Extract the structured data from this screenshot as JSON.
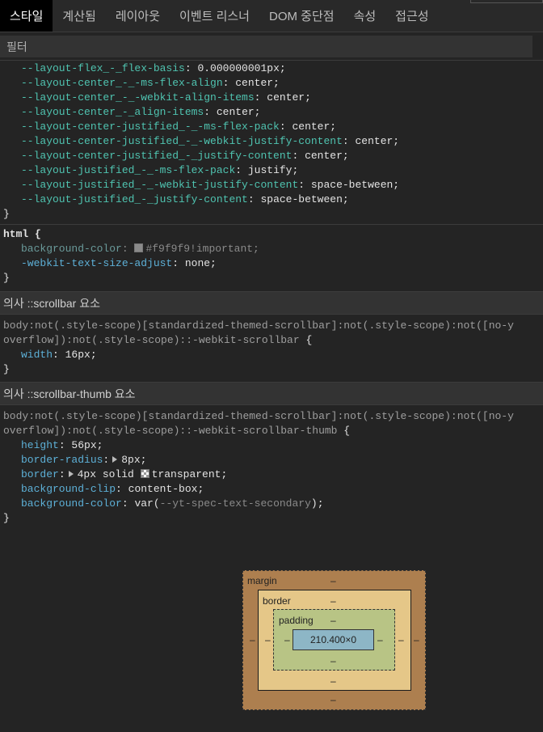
{
  "tabs": [
    "스타일",
    "계산됨",
    "레이아웃",
    "이벤트 리스너",
    "DOM 중단점",
    "속성",
    "접근성"
  ],
  "filter_placeholder": "필터",
  "rule1": {
    "decls": [
      {
        "prop": "--layout-flex_-_flex-basis",
        "value": "0.000000001px;"
      },
      {
        "prop": "--layout-center_-_-ms-flex-align",
        "value": "center;"
      },
      {
        "prop": "--layout-center_-_-webkit-align-items",
        "value": "center;"
      },
      {
        "prop": "--layout-center_-_align-items",
        "value": "center;"
      },
      {
        "prop": "--layout-center-justified_-_-ms-flex-pack",
        "value": "center;"
      },
      {
        "prop": "--layout-center-justified_-_-webkit-justify-content",
        "value": "center;"
      },
      {
        "prop": "--layout-center-justified_-_justify-content",
        "value": "center;"
      },
      {
        "prop": "--layout-justified_-_-ms-flex-pack",
        "value": "justify;"
      },
      {
        "prop": "--layout-justified_-_-webkit-justify-content",
        "value": "space-between;"
      },
      {
        "prop": "--layout-justified_-_justify-content",
        "value": "space-between;"
      }
    ],
    "close": "}"
  },
  "rule2": {
    "selector": "html {",
    "decl1_prop": "background-color",
    "decl1_value": "#f9f9f9!important;",
    "decl1_color": "#f9f9f9",
    "decl2_prop": "-webkit-text-size-adjust",
    "decl2_value": "none;",
    "close": "}"
  },
  "section1": "의사 ::scrollbar 요소",
  "rule3": {
    "selector_line1": "body:not(.style-scope)[standardized-themed-scrollbar]:not(.style-scope):not([no-y",
    "selector_line2": "overflow]):not(.style-scope)::-webkit-scrollbar",
    "brace": " {",
    "decl_prop": "width",
    "decl_value": "16px;",
    "close": "}"
  },
  "section2": "의사 ::scrollbar-thumb 요소",
  "rule4": {
    "selector_line1": "body:not(.style-scope)[standardized-themed-scrollbar]:not(.style-scope):not([no-y",
    "selector_line2": "overflow]):not(.style-scope)::-webkit-scrollbar-thumb",
    "brace": " {",
    "height_prop": "height",
    "height_value": "56px;",
    "radius_prop": "border-radius",
    "radius_value": "8px;",
    "border_prop": "border",
    "border_value_pre": "4px solid ",
    "border_value_post": "transparent;",
    "clip_prop": "background-clip",
    "clip_value": "content-box;",
    "bg_prop": "background-color",
    "bg_value_pre": "var(",
    "bg_value_var": "--yt-spec-text-secondary",
    "bg_value_post": ");",
    "close": "}"
  },
  "box_model": {
    "margin_label": "margin",
    "border_label": "border",
    "padding_label": "padding",
    "content_size": "210.400×0",
    "dash": "–"
  }
}
